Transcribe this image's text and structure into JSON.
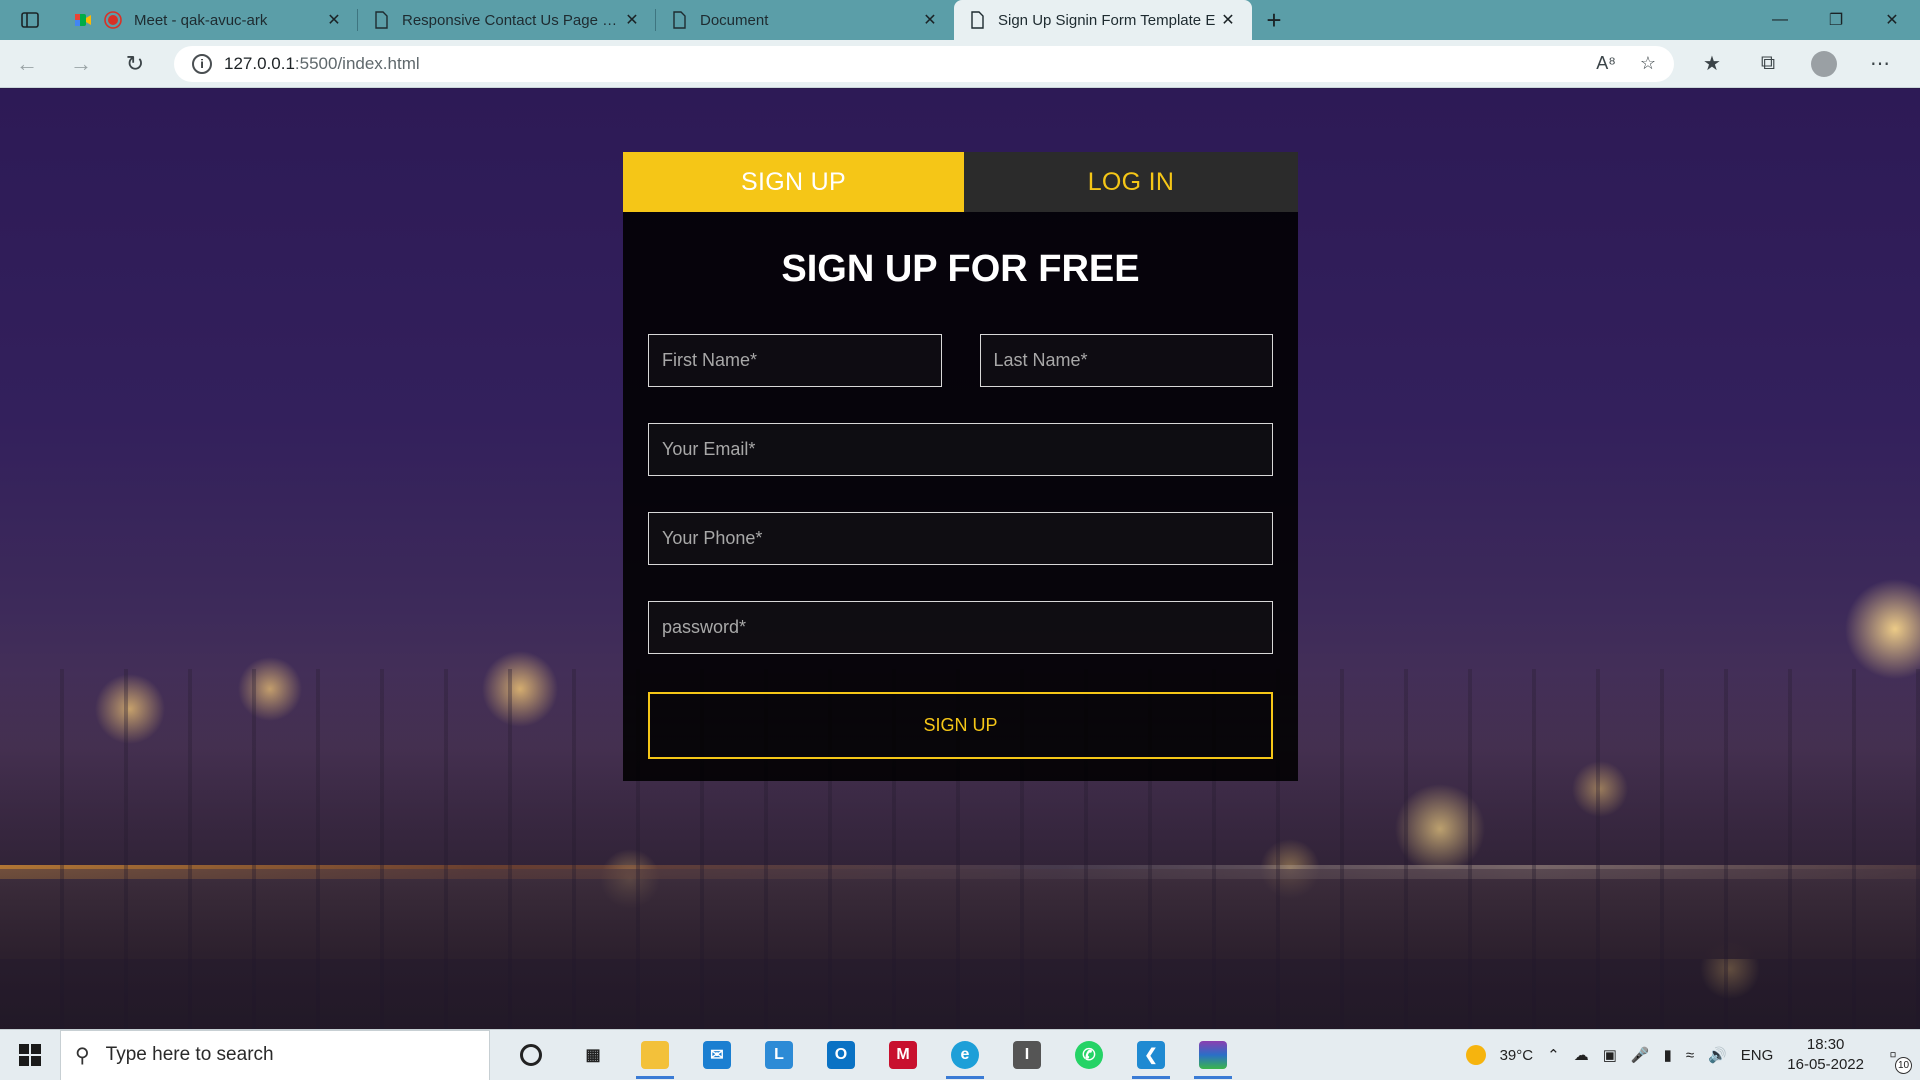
{
  "browser": {
    "tabs": [
      {
        "title": "Meet - qak-avuc-ark",
        "active": false
      },
      {
        "title": "Responsive Contact Us Page Exa",
        "active": false
      },
      {
        "title": "Document",
        "active": false
      },
      {
        "title": "Sign Up Signin Form Template E",
        "active": true
      }
    ],
    "url_host": "127.0.0.1",
    "url_rest": ":5500/index.html",
    "new_tab_symbol": "+",
    "close_symbol": "✕"
  },
  "form": {
    "tab_signup": "SIGN UP",
    "tab_login": "LOG IN",
    "title": "SIGN UP FOR FREE",
    "first_name_placeholder": "First Name*",
    "last_name_placeholder": "Last Name*",
    "email_placeholder": "Your Email*",
    "phone_placeholder": "Your Phone*",
    "password_placeholder": "password*",
    "submit_label": "SIGN UP",
    "accent_color": "#f5c617"
  },
  "taskbar": {
    "search_placeholder": "Type here to search",
    "weather": "39°C",
    "language": "ENG",
    "time": "18:30",
    "date": "16-05-2022",
    "notification_count": "10",
    "apps": [
      "cortana-icon",
      "task-view-icon",
      "file-explorer-icon",
      "mail-icon",
      "l-app-icon",
      "outlook-icon",
      "mcafee-icon",
      "edge-icon",
      "app-icon",
      "whatsapp-icon",
      "vscode-icon",
      "winrar-icon"
    ]
  }
}
